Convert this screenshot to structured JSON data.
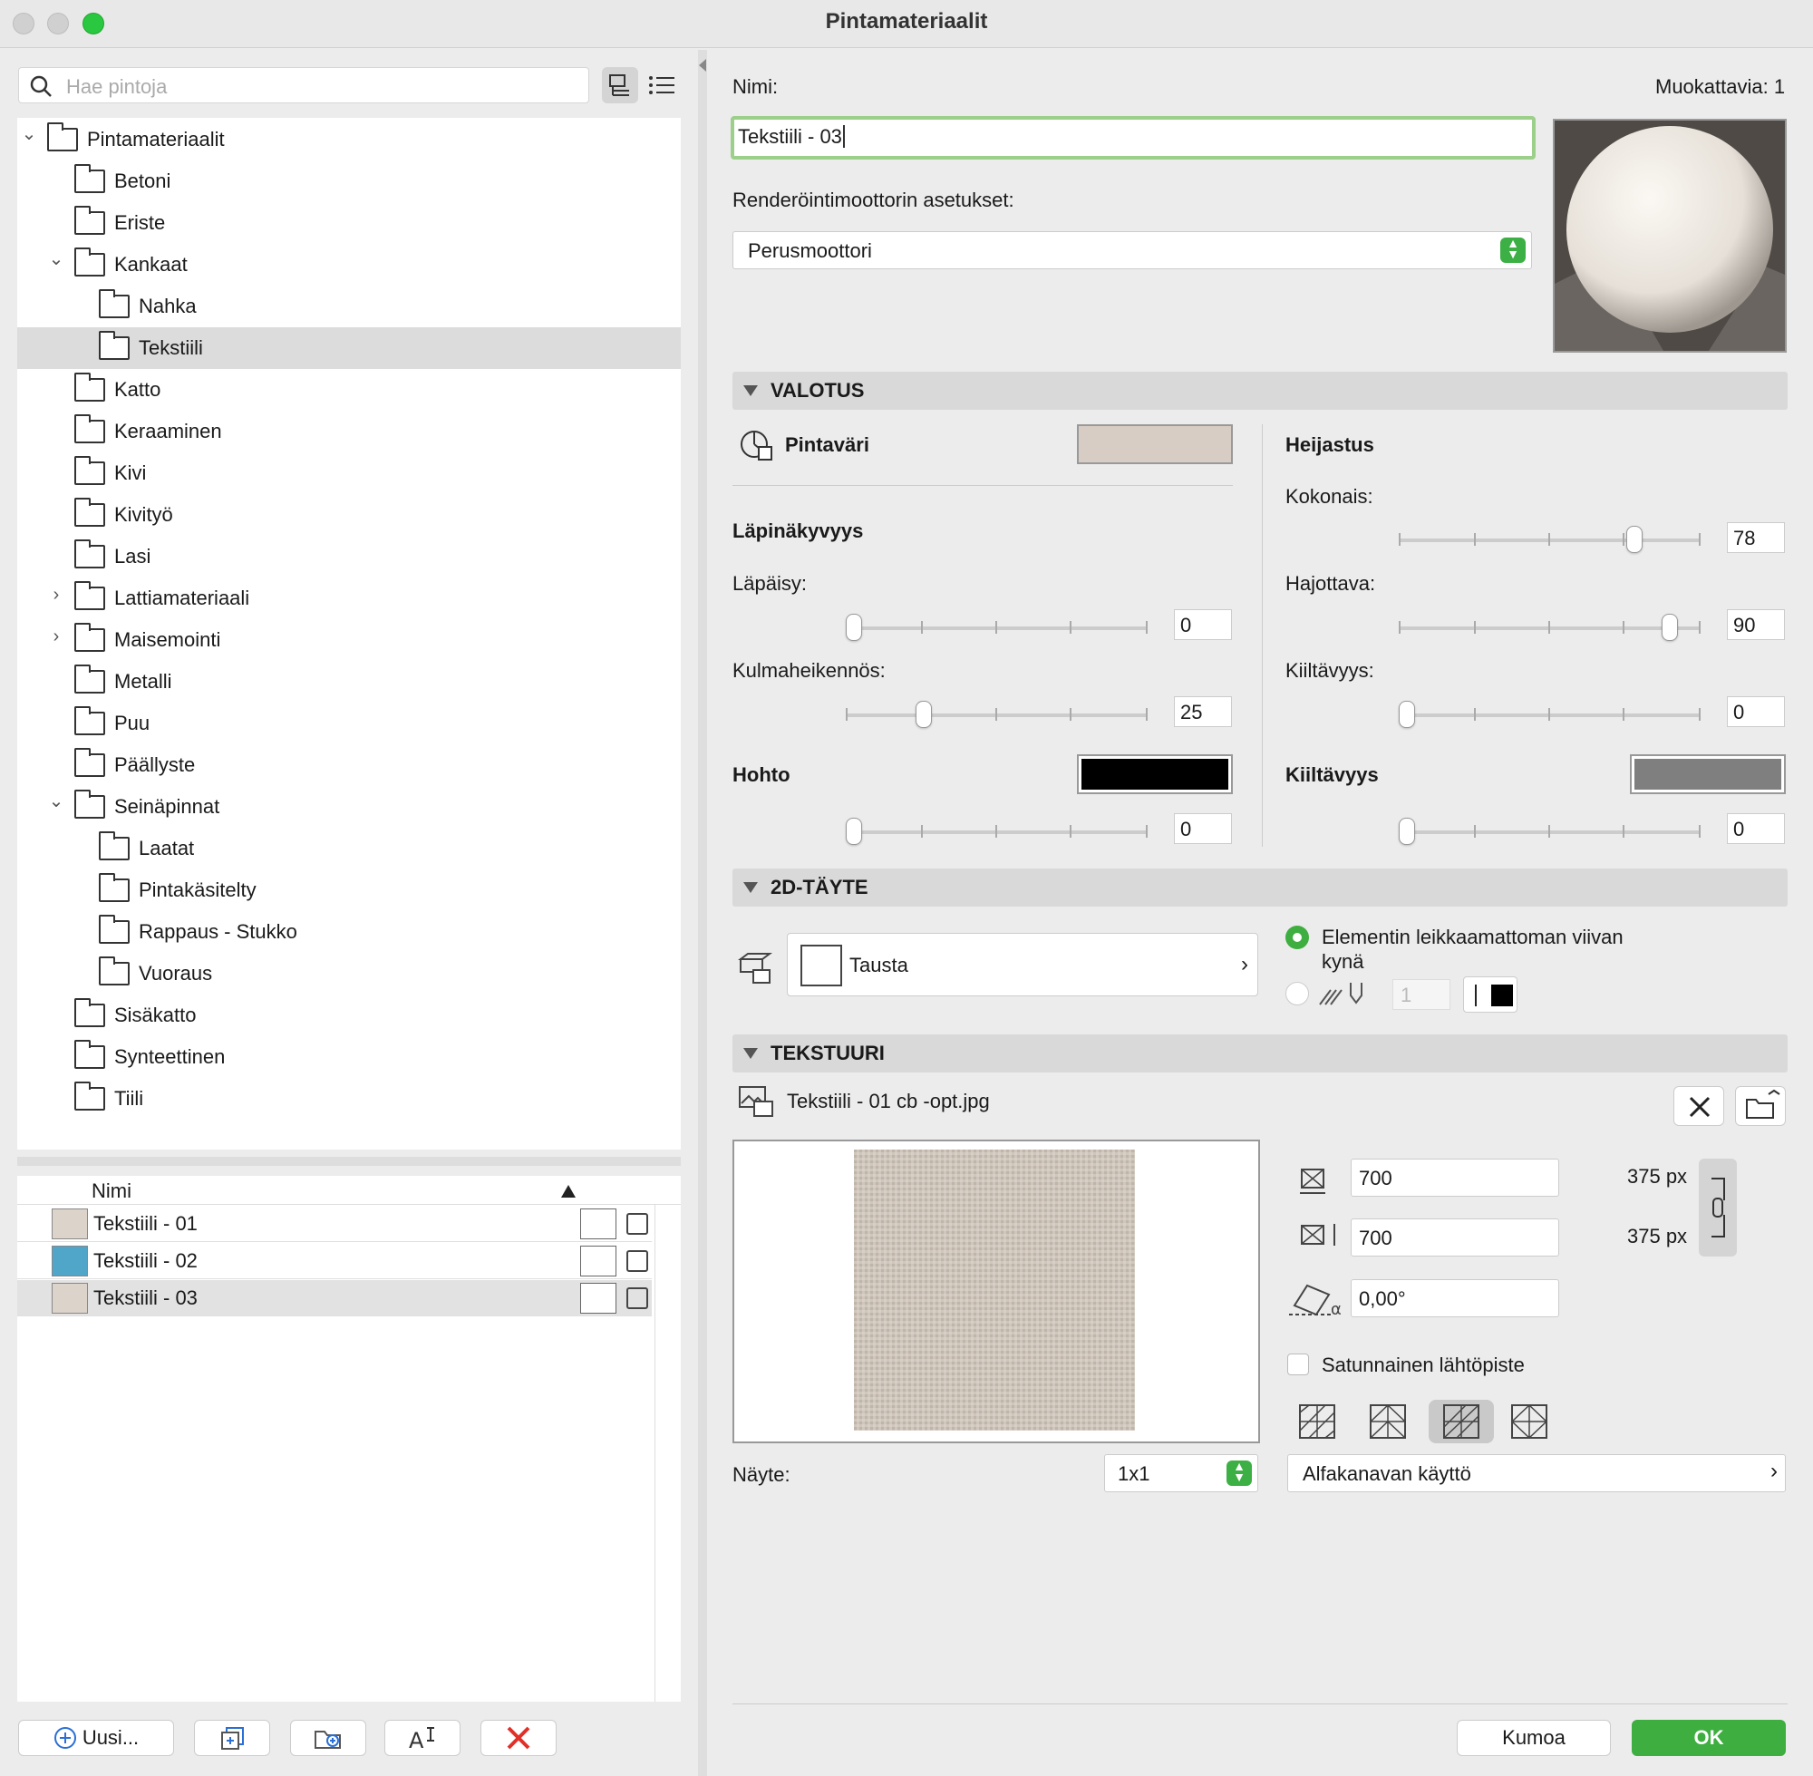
{
  "window": {
    "title": "Pintamateriaalit"
  },
  "search": {
    "placeholder": "Hae pintoja"
  },
  "tree": [
    {
      "label": "Pintamateriaalit",
      "level": 0,
      "expanded": true
    },
    {
      "label": "Betoni",
      "level": 1
    },
    {
      "label": "Eriste",
      "level": 1
    },
    {
      "label": "Kankaat",
      "level": 1,
      "expanded": true
    },
    {
      "label": "Nahka",
      "level": 2
    },
    {
      "label": "Tekstiili",
      "level": 2,
      "selected": true
    },
    {
      "label": "Katto",
      "level": 1
    },
    {
      "label": "Keraaminen",
      "level": 1
    },
    {
      "label": "Kivi",
      "level": 1
    },
    {
      "label": "Kivityö",
      "level": 1
    },
    {
      "label": "Lasi",
      "level": 1
    },
    {
      "label": "Lattiamateriaali",
      "level": 1,
      "collapsed": true
    },
    {
      "label": "Maisemointi",
      "level": 1,
      "collapsed": true
    },
    {
      "label": "Metalli",
      "level": 1
    },
    {
      "label": "Puu",
      "level": 1
    },
    {
      "label": "Päällyste",
      "level": 1
    },
    {
      "label": "Seinäpinnat",
      "level": 1,
      "expanded": true
    },
    {
      "label": "Laatat",
      "level": 2
    },
    {
      "label": "Pintakäsitelty",
      "level": 2
    },
    {
      "label": "Rappaus - Stukko",
      "level": 2
    },
    {
      "label": "Vuoraus",
      "level": 2
    },
    {
      "label": "Sisäkatto",
      "level": 1
    },
    {
      "label": "Synteettinen",
      "level": 1
    },
    {
      "label": "Tiili",
      "level": 1
    }
  ],
  "list": {
    "header": "Nimi",
    "rows": [
      {
        "name": "Tekstiili - 01",
        "color": "#dcd3cb"
      },
      {
        "name": "Tekstiili - 02",
        "color": "#4fa6c8"
      },
      {
        "name": "Tekstiili - 03",
        "color": "#dcd3cb",
        "selected": true
      }
    ]
  },
  "bottom_buttons": {
    "new": "Uusi..."
  },
  "editor": {
    "name_label": "Nimi:",
    "editable_count": "Muokattavia: 1",
    "name_value": "Tekstiili - 03",
    "engine_label": "Renderöintimoottorin asetukset:",
    "engine_value": "Perusmoottori"
  },
  "valotus": {
    "title": "VALOTUS",
    "surface_color_label": "Pintaväri",
    "surface_color": "#d8cdc4",
    "transparency_label": "Läpinäkyvyys",
    "lapaisy_label": "Läpäisy:",
    "lapaisy_value": "0",
    "kulma_label": "Kulmaheikennös:",
    "kulma_value": "25",
    "hohto_label": "Hohto",
    "hohto_value": "0",
    "hohto_color": "#000000",
    "heijastus_label": "Heijastus",
    "kokonais_label": "Kokonais:",
    "kokonais_value": "78",
    "hajottava_label": "Hajottava:",
    "hajottava_value": "90",
    "kiiltavyys_label": "Kiiltävyys:",
    "kiiltavyys_value": "0",
    "kiiltavyys2_label": "Kiiltävyys",
    "kiiltavyys2_value": "0",
    "kiiltavyys_color": "#7f7f7f"
  },
  "fill2d": {
    "title": "2D-TÄYTE",
    "fill_name": "Tausta",
    "radio1_label": "Elementin leikkaamattoman viivan kynä",
    "pen_value": "1"
  },
  "texture": {
    "title": "TEKSTUURI",
    "file": "Tekstiili - 01 cb -opt.jpg",
    "width": "700",
    "height": "700",
    "width_px": "375 px",
    "height_px": "375 px",
    "angle": "0,00°",
    "random_origin_label": "Satunnainen lähtöpiste",
    "sample_label": "Näyte:",
    "sample_value": "1x1",
    "alpha_label": "Alfakanavan käyttö"
  },
  "footer": {
    "cancel": "Kumoa",
    "ok": "OK"
  },
  "colors": {
    "accent_green": "#3dae3f",
    "focus_green": "#9ccf8a"
  }
}
